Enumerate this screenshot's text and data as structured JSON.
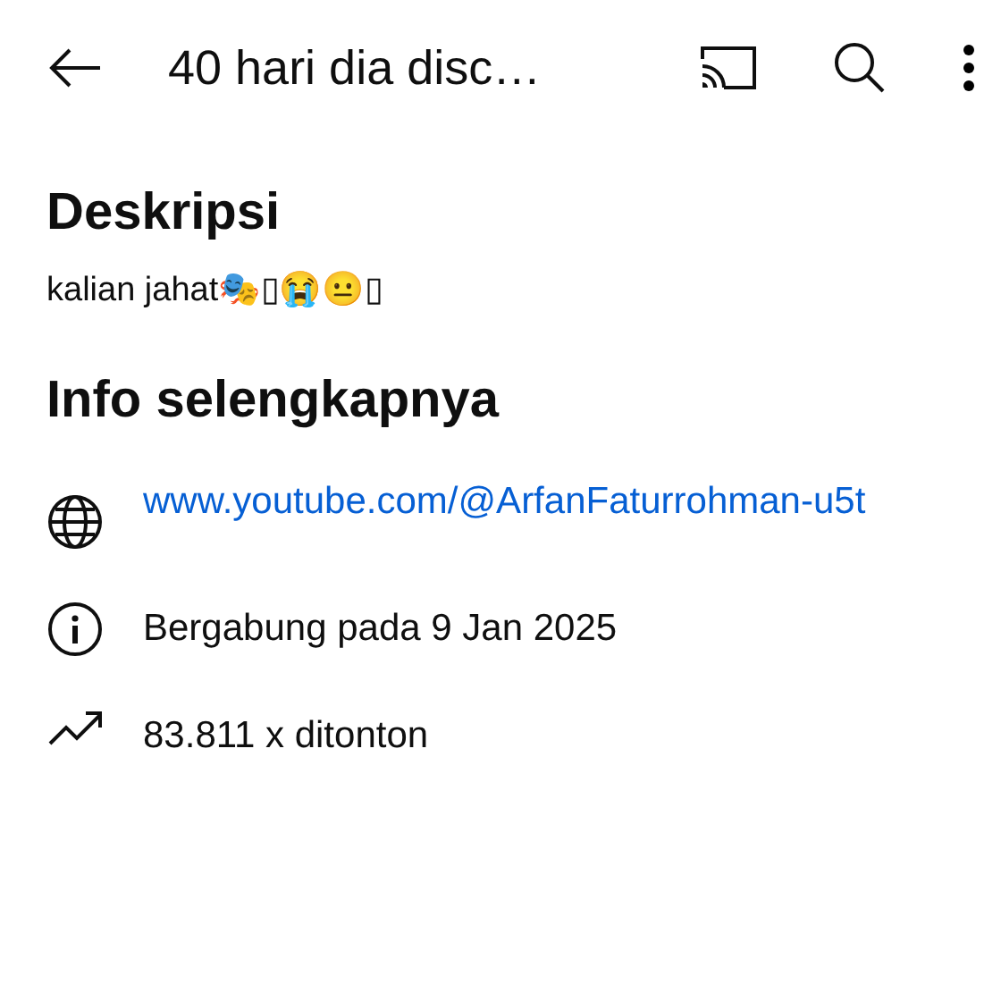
{
  "top_bar": {
    "title": "40 hari dia disc…"
  },
  "description": {
    "heading": "Deskripsi",
    "text": "kalian jahat🎭▯😭😐▯"
  },
  "info": {
    "heading": "Info selengkapnya",
    "rows": [
      {
        "kind": "link",
        "text": "www.youtube.com/@ArfanFaturrohman-u5t"
      },
      {
        "kind": "joined",
        "text": "Bergabung pada 9 Jan 2025"
      },
      {
        "kind": "views",
        "text": "83.811 x ditonton"
      }
    ]
  }
}
